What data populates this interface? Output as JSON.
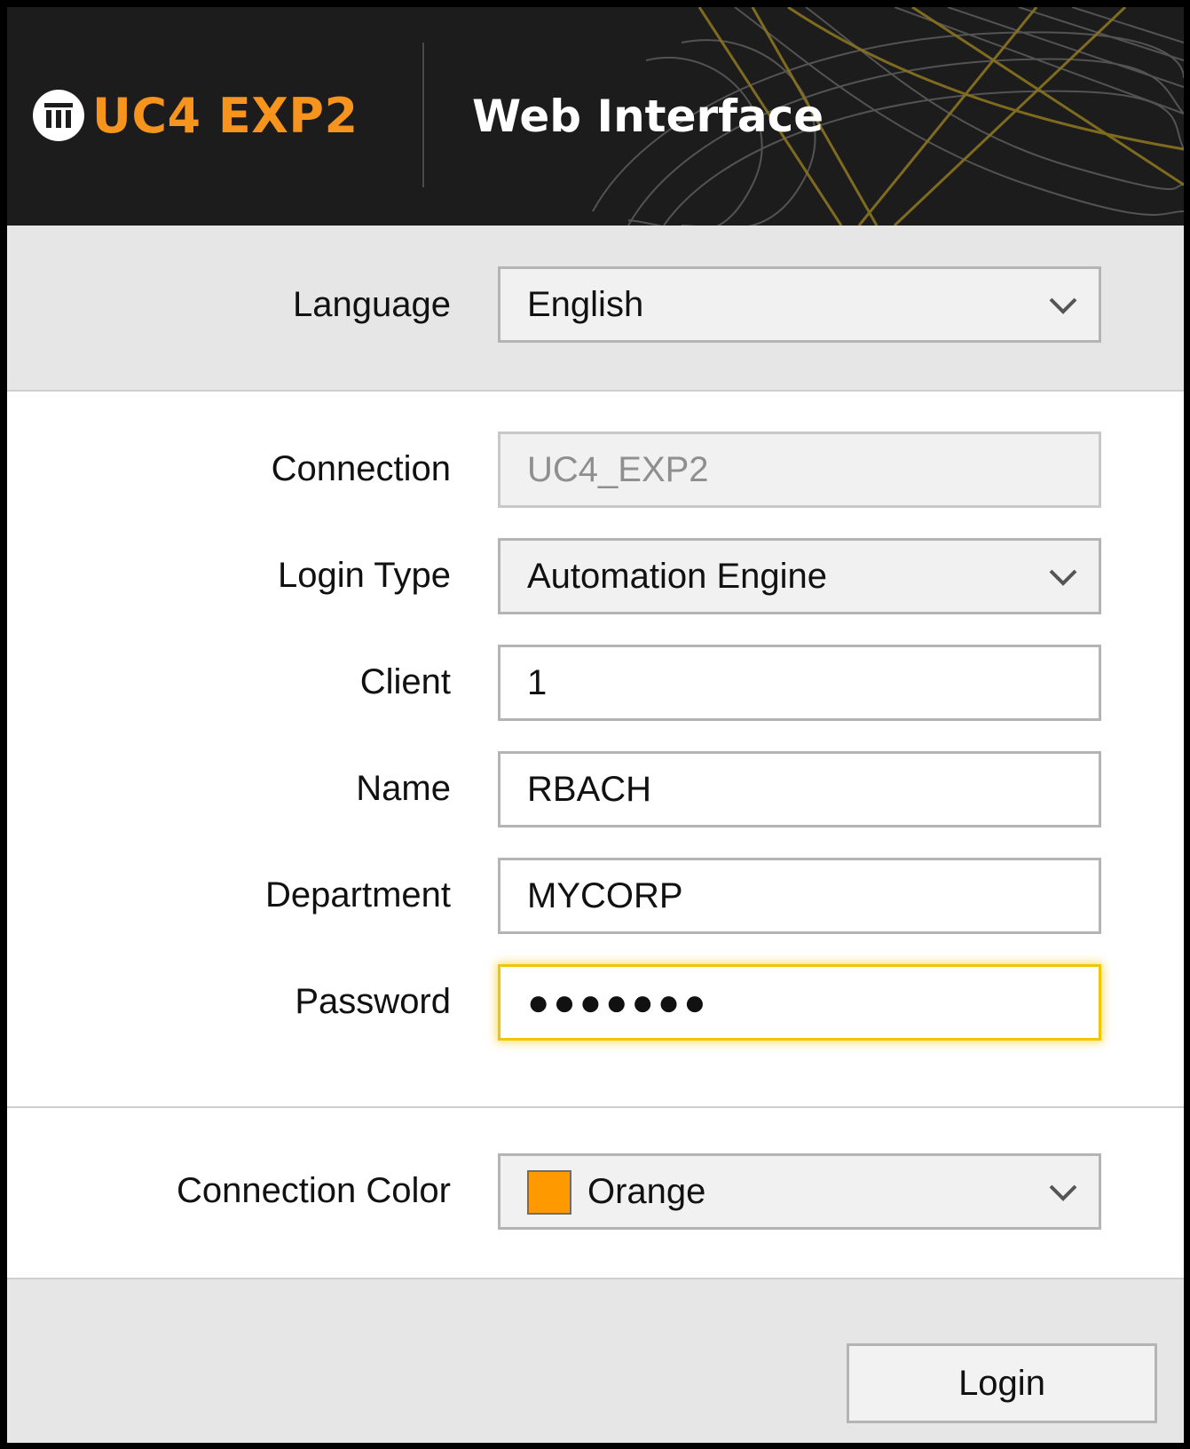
{
  "header": {
    "app_name": "UC4 EXP2",
    "title": "Web Interface",
    "logo_icon": "columns-logo-icon",
    "brand_color": "#f7941d"
  },
  "language": {
    "label": "Language",
    "value": "English"
  },
  "form": {
    "connection": {
      "label": "Connection",
      "value": "UC4_EXP2"
    },
    "login_type": {
      "label": "Login Type",
      "value": "Automation Engine"
    },
    "client": {
      "label": "Client",
      "value": "1"
    },
    "name": {
      "label": "Name",
      "value": "RBACH"
    },
    "department": {
      "label": "Department",
      "value": "MYCORP"
    },
    "password": {
      "label": "Password",
      "value": "●●●●●●●"
    }
  },
  "connection_color": {
    "label": "Connection Color",
    "value": "Orange",
    "swatch_color": "#ff9900"
  },
  "footer": {
    "login_label": "Login"
  },
  "colors": {
    "header_bg": "#1c1c1c",
    "focus_outline": "#f3c400",
    "section_bg": "#e6e6e6"
  }
}
